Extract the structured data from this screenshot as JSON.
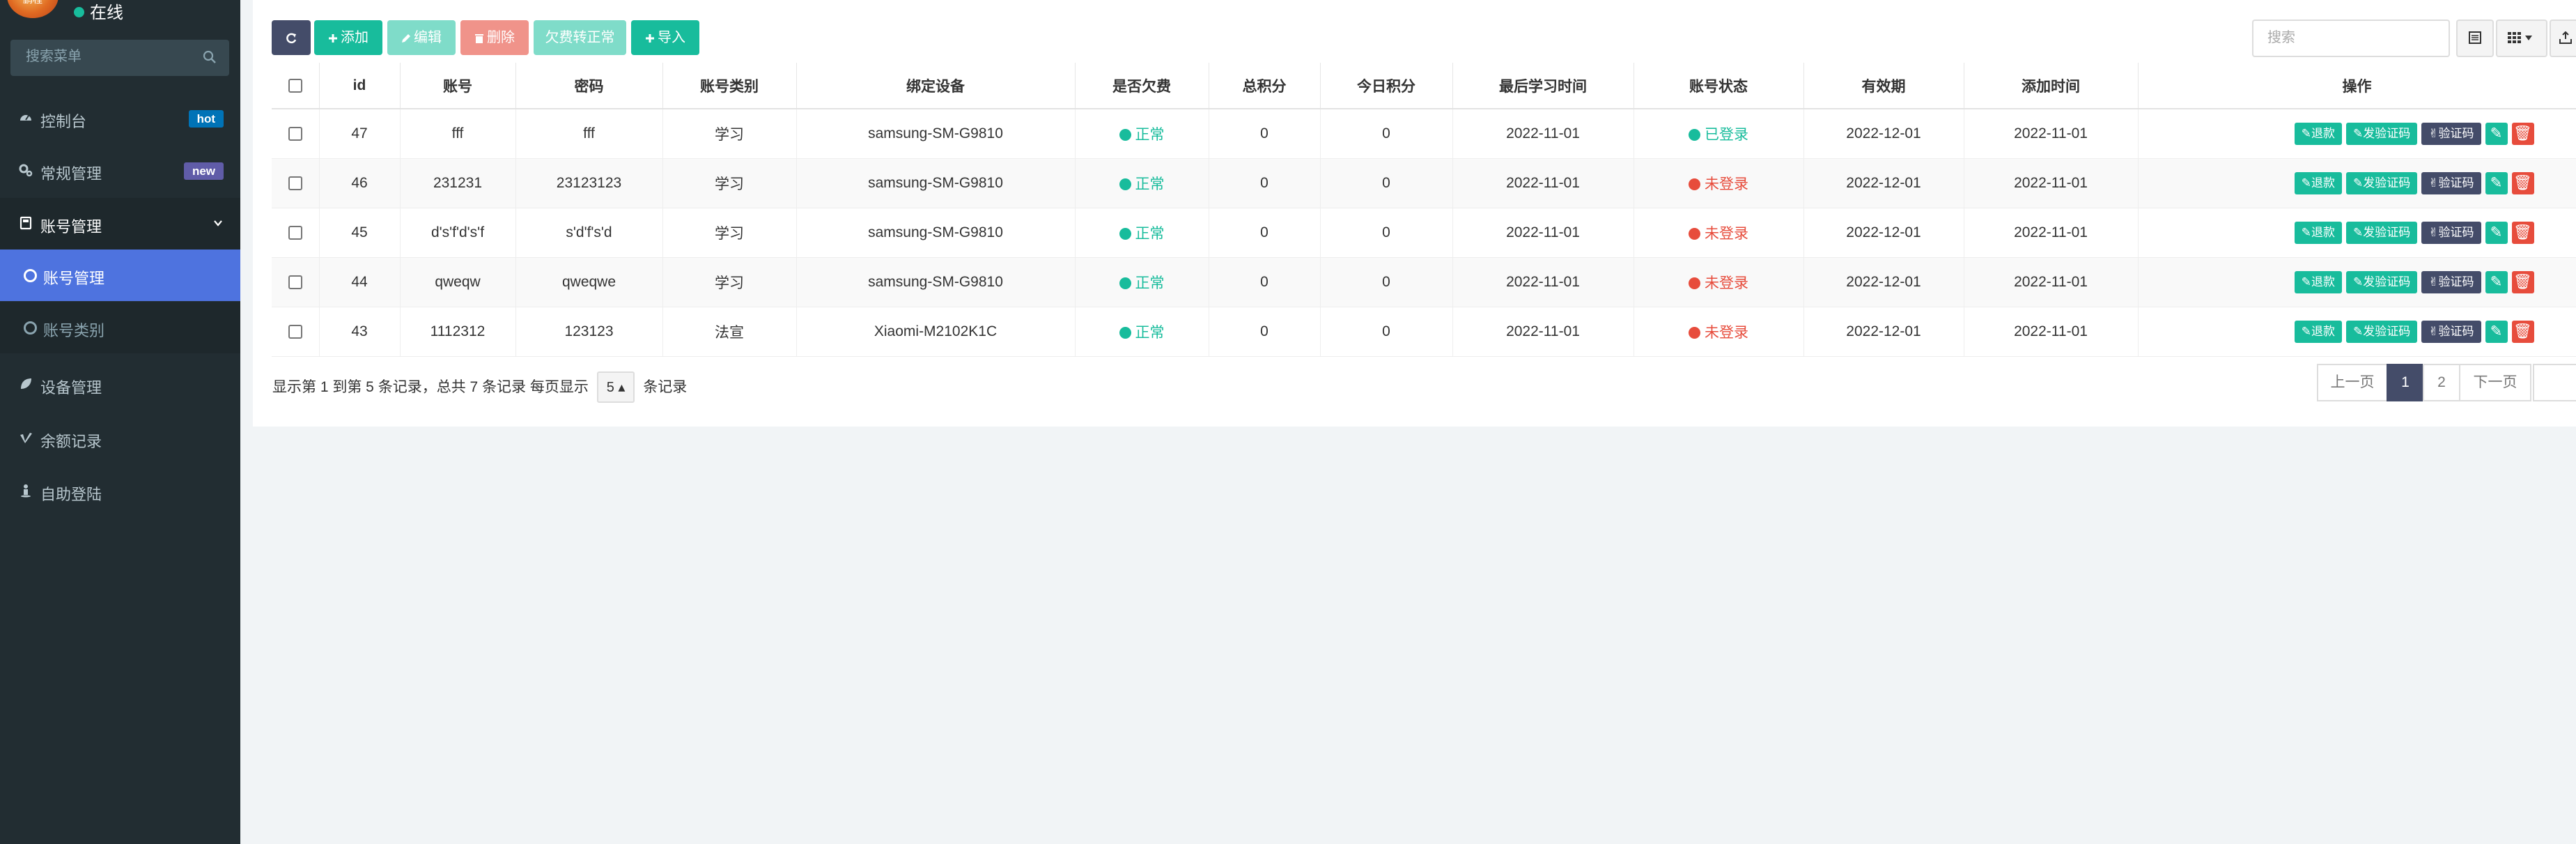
{
  "user": {
    "avatar_text": "鹏程",
    "status": "在线"
  },
  "sidebar": {
    "search_placeholder": "搜索菜单",
    "items": [
      {
        "label": "控制台",
        "icon": "dashboard-icon",
        "badge": "hot",
        "badge_color": "#0073b7"
      },
      {
        "label": "常规管理",
        "icon": "cogs-icon",
        "badge": "new",
        "badge_color": "#605ca8"
      },
      {
        "label": "账号管理",
        "icon": "book-icon"
      },
      {
        "label": "设备管理",
        "icon": "leaf-icon"
      },
      {
        "label": "余额记录",
        "icon": "vimeo-icon"
      },
      {
        "label": "自助登陆",
        "icon": "street-view-icon"
      }
    ],
    "subitems": [
      {
        "label": "账号管理",
        "active": true
      },
      {
        "label": "账号类别",
        "active": false
      }
    ]
  },
  "toolbar": {
    "refresh_icon": "refresh-icon",
    "add": "添加",
    "edit": "编辑",
    "delete": "删除",
    "arrears_normal": "欠费转正常",
    "import": "导入",
    "search_placeholder": "搜索"
  },
  "table": {
    "headers": [
      "id",
      "账号",
      "密码",
      "账号类别",
      "绑定设备",
      "是否欠费",
      "总积分",
      "今日积分",
      "最后学习时间",
      "账号状态",
      "有效期",
      "添加时间",
      "操作"
    ],
    "rows": [
      {
        "id": "47",
        "account": "fff",
        "password": "fff",
        "type": "学习",
        "device": "samsung-SM-G9810",
        "arrears": "正常",
        "total": "0",
        "today": "0",
        "last_study": "2022-11-01",
        "status": "已登录",
        "status_color": "#18bc9c",
        "expiry": "2022-12-01",
        "added": "2022-11-01"
      },
      {
        "id": "46",
        "account": "231231",
        "password": "23123123",
        "type": "学习",
        "device": "samsung-SM-G9810",
        "arrears": "正常",
        "total": "0",
        "today": "0",
        "last_study": "2022-11-01",
        "status": "未登录",
        "status_color": "#e74c3c",
        "expiry": "2022-12-01",
        "added": "2022-11-01"
      },
      {
        "id": "45",
        "account": "d's'f'd's'f",
        "password": "s'd'f's'd",
        "type": "学习",
        "device": "samsung-SM-G9810",
        "arrears": "正常",
        "total": "0",
        "today": "0",
        "last_study": "2022-11-01",
        "status": "未登录",
        "status_color": "#e74c3c",
        "expiry": "2022-12-01",
        "added": "2022-11-01"
      },
      {
        "id": "44",
        "account": "qweqw",
        "password": "qweqwe",
        "type": "学习",
        "device": "samsung-SM-G9810",
        "arrears": "正常",
        "total": "0",
        "today": "0",
        "last_study": "2022-11-01",
        "status": "未登录",
        "status_color": "#e74c3c",
        "expiry": "2022-12-01",
        "added": "2022-11-01"
      },
      {
        "id": "43",
        "account": "1112312",
        "password": "123123",
        "type": "法宣",
        "device": "Xiaomi-M2102K1C",
        "arrears": "正常",
        "total": "0",
        "today": "0",
        "last_study": "2022-11-01",
        "status": "未登录",
        "status_color": "#e74c3c",
        "expiry": "2022-12-01",
        "added": "2022-11-01"
      }
    ],
    "actions": {
      "refund": "退款",
      "send_code": "发验证码",
      "verify_code": "验证码"
    }
  },
  "footer": {
    "info_prefix": "显示第 1 到第 5 条记录，总共 7 条记录 每页显示",
    "page_size": "5",
    "info_suffix": "条记录",
    "prev": "上一页",
    "pages": [
      "1",
      "2"
    ],
    "next": "下一页"
  },
  "colors": {
    "sidebar_bg": "#222d32",
    "accent": "#18bc9c",
    "active_nav": "#4e73df",
    "danger": "#e74c3c",
    "dark_btn": "#444c69"
  }
}
